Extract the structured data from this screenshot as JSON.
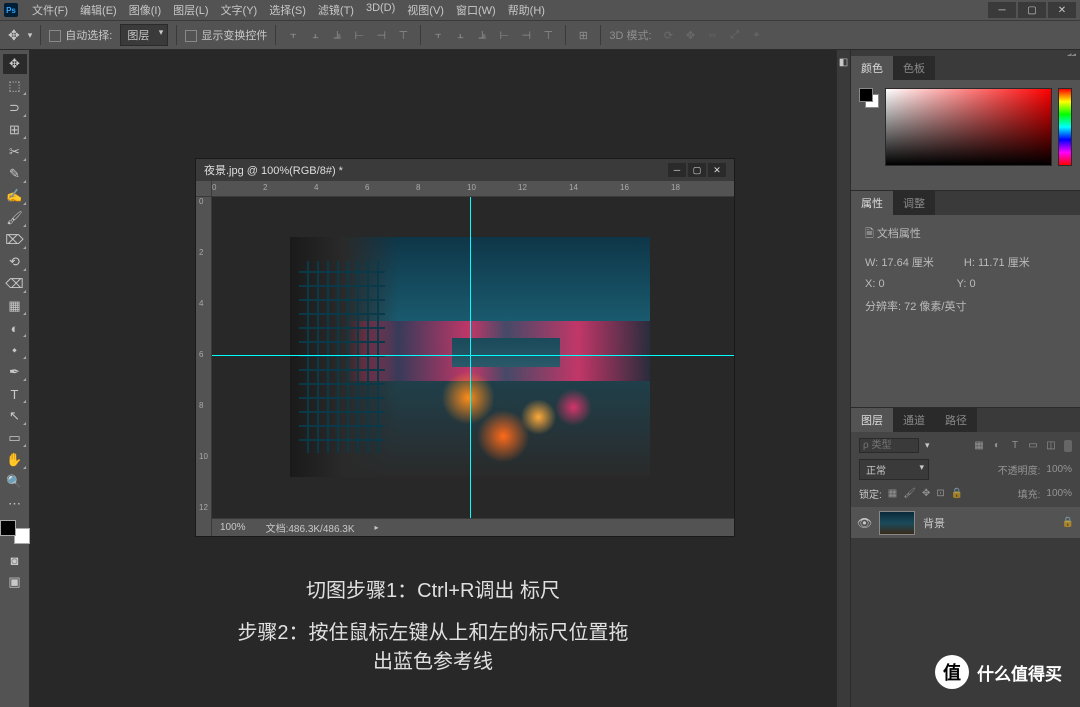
{
  "menu": [
    "文件(F)",
    "编辑(E)",
    "图像(I)",
    "图层(L)",
    "文字(Y)",
    "选择(S)",
    "滤镜(T)",
    "3D(D)",
    "视图(V)",
    "窗口(W)",
    "帮助(H)"
  ],
  "optionBar": {
    "autoSelect": "自动选择:",
    "layerDropdown": "图层",
    "showTransform": "显示变换控件",
    "mode3d": "3D 模式:"
  },
  "tools": [
    {
      "icon": "✥",
      "name": "move-tool",
      "active": true,
      "corner": false
    },
    {
      "icon": "⬚",
      "name": "marquee-tool",
      "corner": true
    },
    {
      "icon": "⊃",
      "name": "lasso-tool",
      "corner": true
    },
    {
      "icon": "⊞",
      "name": "quick-select-tool",
      "corner": true
    },
    {
      "icon": "✂",
      "name": "crop-tool",
      "corner": true
    },
    {
      "icon": "✎",
      "name": "eyedropper-tool",
      "corner": true
    },
    {
      "icon": "✍",
      "name": "healing-tool",
      "corner": true
    },
    {
      "icon": "🖌",
      "name": "brush-tool",
      "corner": true
    },
    {
      "icon": "⌦",
      "name": "stamp-tool",
      "corner": true
    },
    {
      "icon": "⟲",
      "name": "history-brush-tool",
      "corner": true
    },
    {
      "icon": "⌫",
      "name": "eraser-tool",
      "corner": true
    },
    {
      "icon": "▦",
      "name": "gradient-tool",
      "corner": true
    },
    {
      "icon": "◐",
      "name": "blur-tool",
      "corner": true
    },
    {
      "icon": "⬩",
      "name": "dodge-tool",
      "corner": true
    },
    {
      "icon": "✒",
      "name": "pen-tool",
      "corner": true
    },
    {
      "icon": "T",
      "name": "type-tool",
      "corner": true
    },
    {
      "icon": "↖",
      "name": "path-select-tool",
      "corner": true
    },
    {
      "icon": "▭",
      "name": "rectangle-tool",
      "corner": true
    },
    {
      "icon": "✋",
      "name": "hand-tool",
      "corner": true
    },
    {
      "icon": "🔍",
      "name": "zoom-tool",
      "corner": false
    },
    {
      "icon": "⋯",
      "name": "edit-toolbar",
      "corner": false
    }
  ],
  "document": {
    "title": "夜景.jpg @ 100%(RGB/8#) *",
    "zoom": "100%",
    "fileInfo": "文档:486.3K/486.3K",
    "rulerH": [
      "0",
      "2",
      "4",
      "6",
      "8",
      "10",
      "12",
      "14",
      "16",
      "18"
    ],
    "rulerV": [
      "0",
      "2",
      "4",
      "6",
      "8",
      "10",
      "12"
    ]
  },
  "tutorial": {
    "step1": "切图步骤1：Ctrl+R调出 标尺",
    "step2": "步骤2：按住鼠标左键从上和左的标尺位置拖出蓝色参考线"
  },
  "panels": {
    "colorTab": "颜色",
    "swatchTab": "色板",
    "propsTab": "属性",
    "adjTab": "调整",
    "propsTitle": "文档属性",
    "props": {
      "wLabel": "W:",
      "wVal": "17.64 厘米",
      "hLabel": "H:",
      "hVal": "11.71 厘米",
      "xLabel": "X:",
      "xVal": "0",
      "yLabel": "Y:",
      "yVal": "0",
      "resLabel": "分辨率:",
      "resVal": "72 像素/英寸"
    },
    "layersTab": "图层",
    "channelsTab": "通道",
    "pathsTab": "路径",
    "filterType": "类型",
    "blendMode": "正常",
    "opacityLabel": "不透明度:",
    "opacityVal": "100%",
    "lockLabel": "锁定:",
    "fillLabel": "填充:",
    "fillVal": "100%",
    "bgLayerName": "背景",
    "searchPlaceholder": "ρ 类型"
  },
  "watermark": {
    "badge": "值",
    "text": "什么值得买"
  }
}
